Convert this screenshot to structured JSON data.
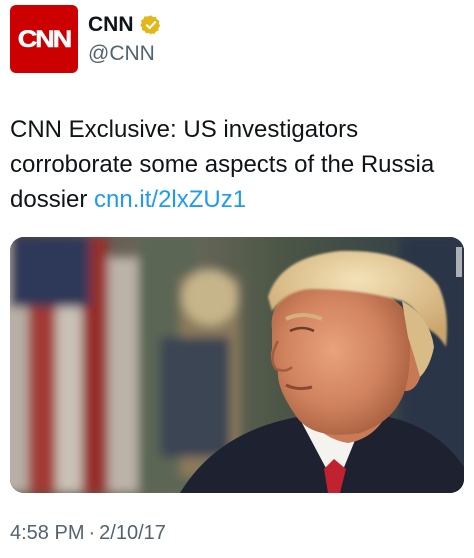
{
  "account": {
    "avatar_text": "CNN",
    "display_name": "CNN",
    "handle": "@CNN",
    "verified": true
  },
  "tweet": {
    "text": "CNN Exclusive: US investigators corroborate some aspects of the Russia dossier",
    "link_text": "cnn.it/2lxZUz1"
  },
  "meta": {
    "time": "4:58 PM",
    "separator": "·",
    "date": "2/10/17"
  },
  "colors": {
    "brand_red": "#cc0000",
    "link_blue": "#1d9bf0",
    "verified_gold": "#e2b719",
    "muted_text": "#536471"
  },
  "icons": {
    "verified": "verified-badge-icon"
  }
}
